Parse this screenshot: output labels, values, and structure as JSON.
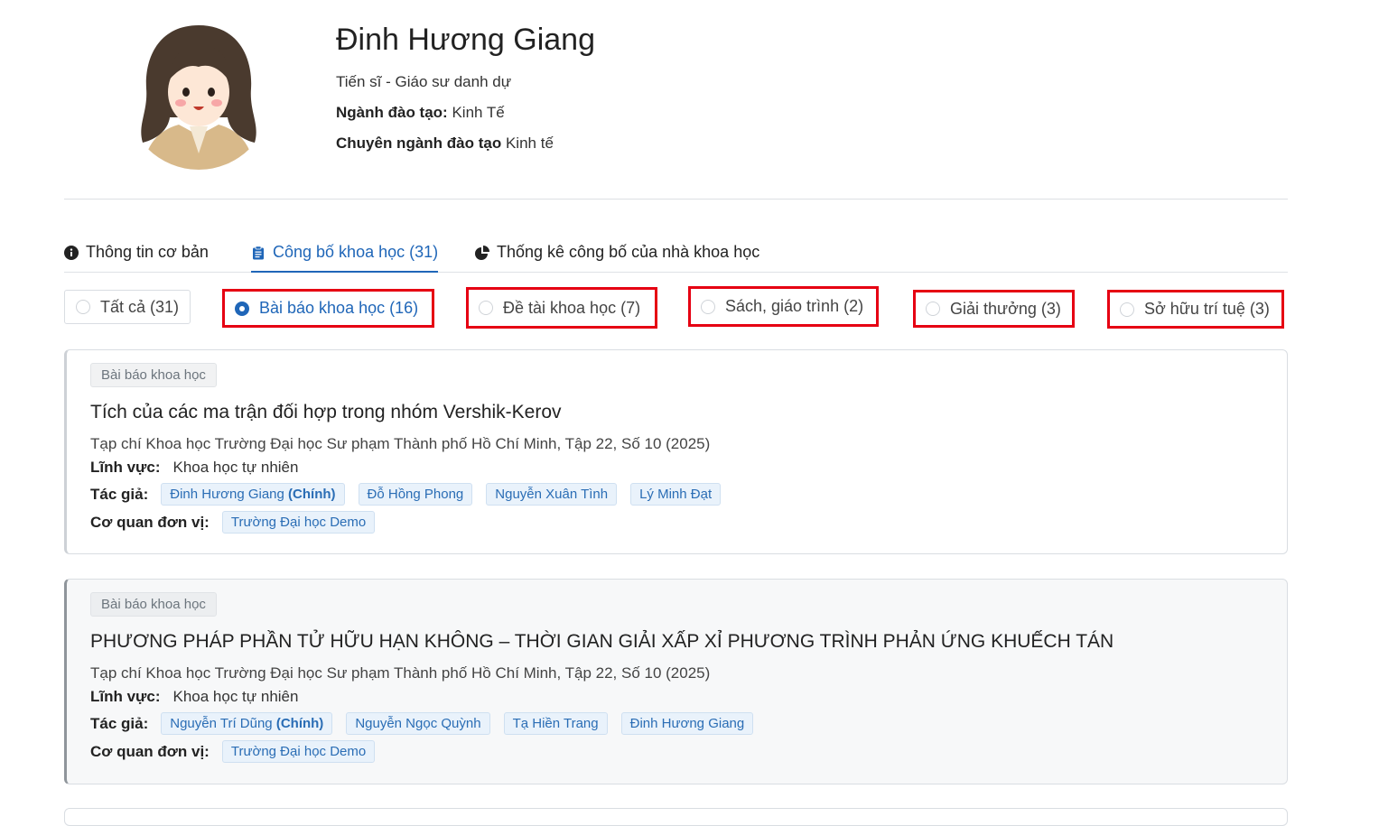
{
  "profile": {
    "name": "Đinh Hương Giang",
    "degree": "Tiến sĩ - Giáo sư danh dự",
    "field_label": "Ngành đào tạo:",
    "field_value": "Kinh Tế",
    "major_label": "Chuyên ngành đào tạo",
    "major_value": "Kinh tế"
  },
  "tabs": [
    {
      "label": "Thông tin cơ bản",
      "icon": "info-icon"
    },
    {
      "label": "Công bố khoa học (31)",
      "icon": "clipboard-list-icon",
      "active": true
    },
    {
      "label": "Thống kê công bố của nhà khoa học",
      "icon": "pie-chart-icon"
    }
  ],
  "filters": [
    {
      "label": "Tất cả (31)"
    },
    {
      "label": "Bài báo khoa học (16)",
      "selected": true
    },
    {
      "label": "Đề tài khoa học (7)"
    },
    {
      "label": "Sách, giáo trình (2)"
    },
    {
      "label": "Giải thưởng (3)"
    },
    {
      "label": "Sở hữu trí tuệ (3)"
    }
  ],
  "highlight_color": "#e60012",
  "accent_color": "#1f66b8",
  "labels": {
    "field": "Lĩnh vực:",
    "authors": "Tác giả:",
    "org": "Cơ quan đơn vị:",
    "main_author": "(Chính)"
  },
  "publications": [
    {
      "type": "Bài báo khoa học",
      "title": "Tích của các ma trận đối hợp trong nhóm Vershik-Kerov",
      "journal": "Tạp chí Khoa học Trường Đại học Sư phạm Thành phố Hồ Chí Minh, Tập 22, Số 10 (2025)",
      "field": "Khoa học tự nhiên",
      "authors": [
        "Đinh Hương Giang",
        "Đỗ Hồng Phong",
        "Nguyễn Xuân Tình",
        "Lý Minh Đạt"
      ],
      "org": "Trường Đại học Demo"
    },
    {
      "type": "Bài báo khoa học",
      "title": "PHƯƠNG PHÁP PHẦN TỬ HỮU HẠN KHÔNG – THỜI GIAN GIẢI XẤP XỈ PHƯƠNG TRÌNH PHẢN ỨNG KHUẾCH TÁN",
      "journal": "Tạp chí Khoa học Trường Đại học Sư phạm Thành phố Hồ Chí Minh, Tập 22, Số 10 (2025)",
      "field": "Khoa học tự nhiên",
      "authors": [
        "Nguyễn Trí Dũng",
        "Nguyễn Ngọc Quỳnh",
        "Tạ Hiền Trang",
        "Đinh Hương Giang"
      ],
      "org": "Trường Đại học Demo"
    }
  ]
}
